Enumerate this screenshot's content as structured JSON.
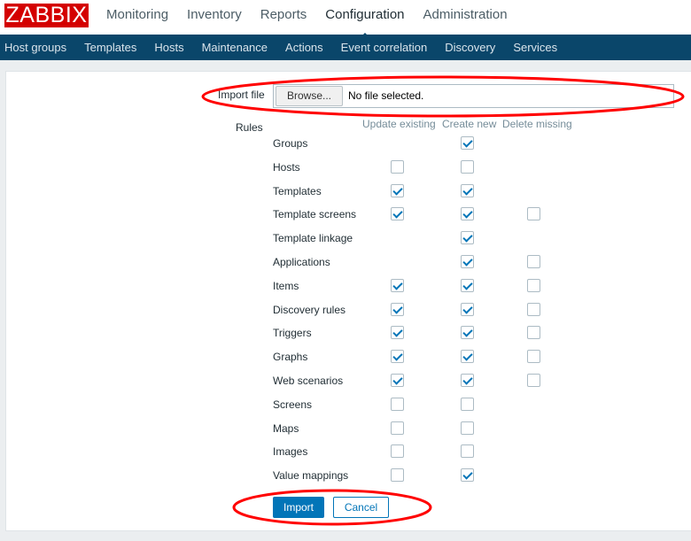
{
  "logo": "ZABBIX",
  "top_nav": [
    {
      "label": "Monitoring",
      "active": false
    },
    {
      "label": "Inventory",
      "active": false
    },
    {
      "label": "Reports",
      "active": false
    },
    {
      "label": "Configuration",
      "active": true
    },
    {
      "label": "Administration",
      "active": false
    }
  ],
  "sub_nav": [
    "Host groups",
    "Templates",
    "Hosts",
    "Maintenance",
    "Actions",
    "Event correlation",
    "Discovery",
    "Services"
  ],
  "form": {
    "import_file_label": "Import file",
    "browse_label": "Browse...",
    "file_status": "No file selected.",
    "rules_label": "Rules",
    "columns": [
      "Update existing",
      "Create new",
      "Delete missing"
    ],
    "rules": [
      {
        "name": "Groups",
        "update": null,
        "create": true,
        "delete": null
      },
      {
        "name": "Hosts",
        "update": false,
        "create": false,
        "delete": null
      },
      {
        "name": "Templates",
        "update": true,
        "create": true,
        "delete": null
      },
      {
        "name": "Template screens",
        "update": true,
        "create": true,
        "delete": false
      },
      {
        "name": "Template linkage",
        "update": null,
        "create": true,
        "delete": null
      },
      {
        "name": "Applications",
        "update": null,
        "create": true,
        "delete": false
      },
      {
        "name": "Items",
        "update": true,
        "create": true,
        "delete": false
      },
      {
        "name": "Discovery rules",
        "update": true,
        "create": true,
        "delete": false
      },
      {
        "name": "Triggers",
        "update": true,
        "create": true,
        "delete": false
      },
      {
        "name": "Graphs",
        "update": true,
        "create": true,
        "delete": false
      },
      {
        "name": "Web scenarios",
        "update": true,
        "create": true,
        "delete": false
      },
      {
        "name": "Screens",
        "update": false,
        "create": false,
        "delete": null
      },
      {
        "name": "Maps",
        "update": false,
        "create": false,
        "delete": null
      },
      {
        "name": "Images",
        "update": false,
        "create": false,
        "delete": null
      },
      {
        "name": "Value mappings",
        "update": false,
        "create": true,
        "delete": null
      }
    ],
    "import_button": "Import",
    "cancel_button": "Cancel"
  },
  "colors": {
    "brand": "#d40000",
    "nav_bg": "#0a466a",
    "accent": "#0275b8",
    "annotation": "#ff0000"
  }
}
